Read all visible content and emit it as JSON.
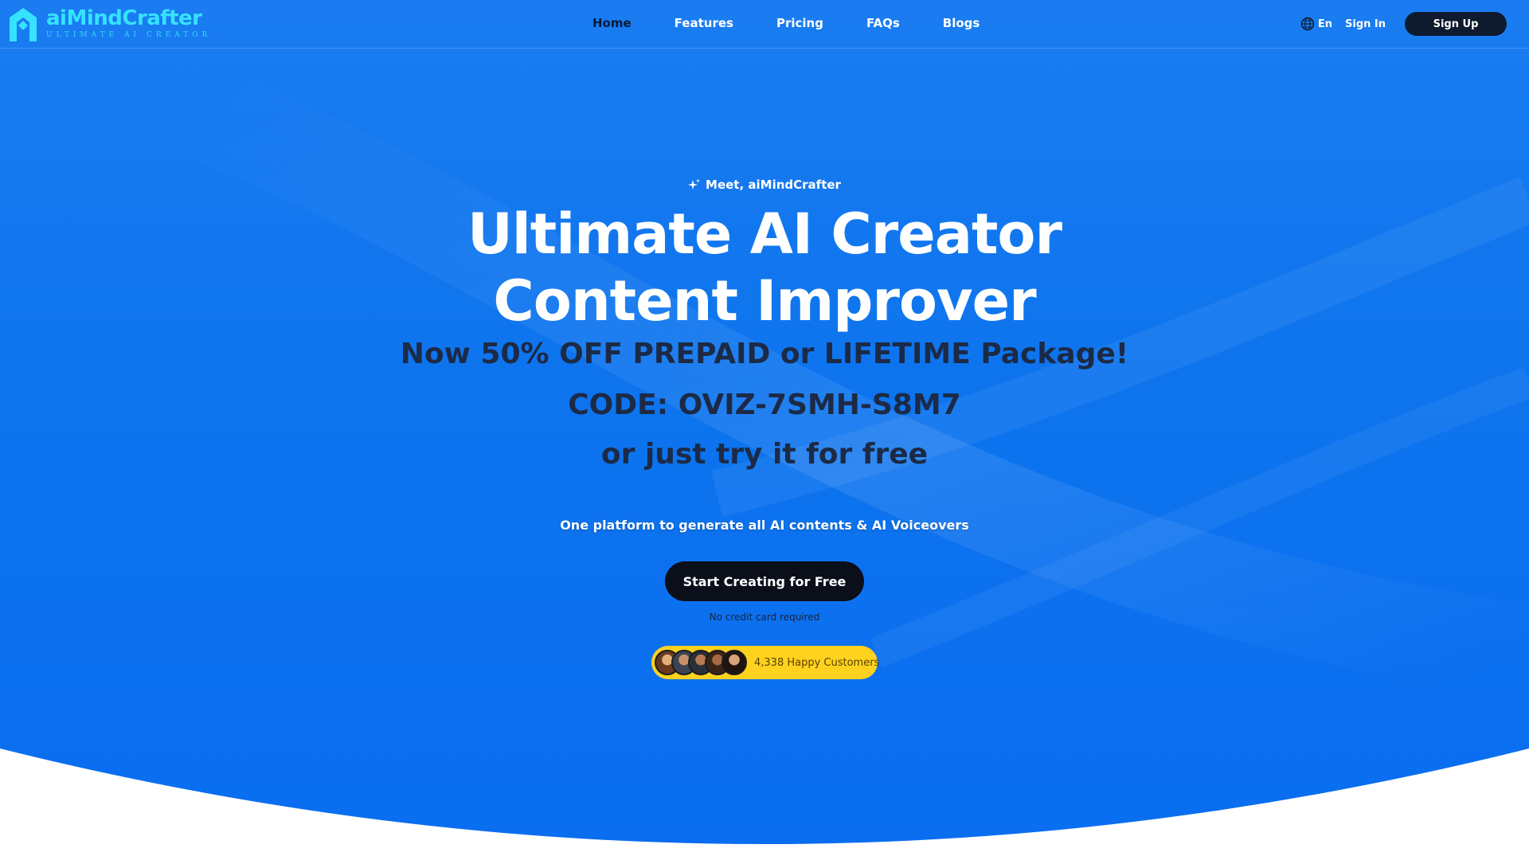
{
  "header": {
    "logo_name": "aiMindCrafter",
    "logo_tagline": "ULTIMATE AI CREATOR",
    "nav": [
      {
        "label": "Home",
        "active": true
      },
      {
        "label": "Features",
        "active": false
      },
      {
        "label": "Pricing",
        "active": false
      },
      {
        "label": "FAQs",
        "active": false
      },
      {
        "label": "Blogs",
        "active": false
      }
    ],
    "language": "En",
    "language_icon": "globe-icon",
    "signin_label": "Sign In",
    "signup_label": "Sign Up"
  },
  "hero": {
    "eyebrow": "Meet, aiMindCrafter",
    "eyebrow_icon": "sparkle-icon",
    "title_line1": "Ultimate AI Creator",
    "title_line2": "Content Improver",
    "promo": "Now 50% OFF PREPAID or LIFETIME Package!",
    "code": "CODE: OVIZ-7SMH-S8M7",
    "try_free": "or just try it for free",
    "subtitle": "One platform to generate all AI contents & AI Voiceovers",
    "cta_label": "Start Creating for Free",
    "cta_note": "No credit card required",
    "customers_label": "4,338 Happy Customers",
    "avatar_count": 5
  },
  "colors": {
    "brand_cyan": "#36e2ff",
    "hero_blue": "#0d74ee",
    "dark_text": "#1c2a46",
    "cta_bg": "#0a0f1a",
    "badge_yellow": "#ffd21f"
  }
}
